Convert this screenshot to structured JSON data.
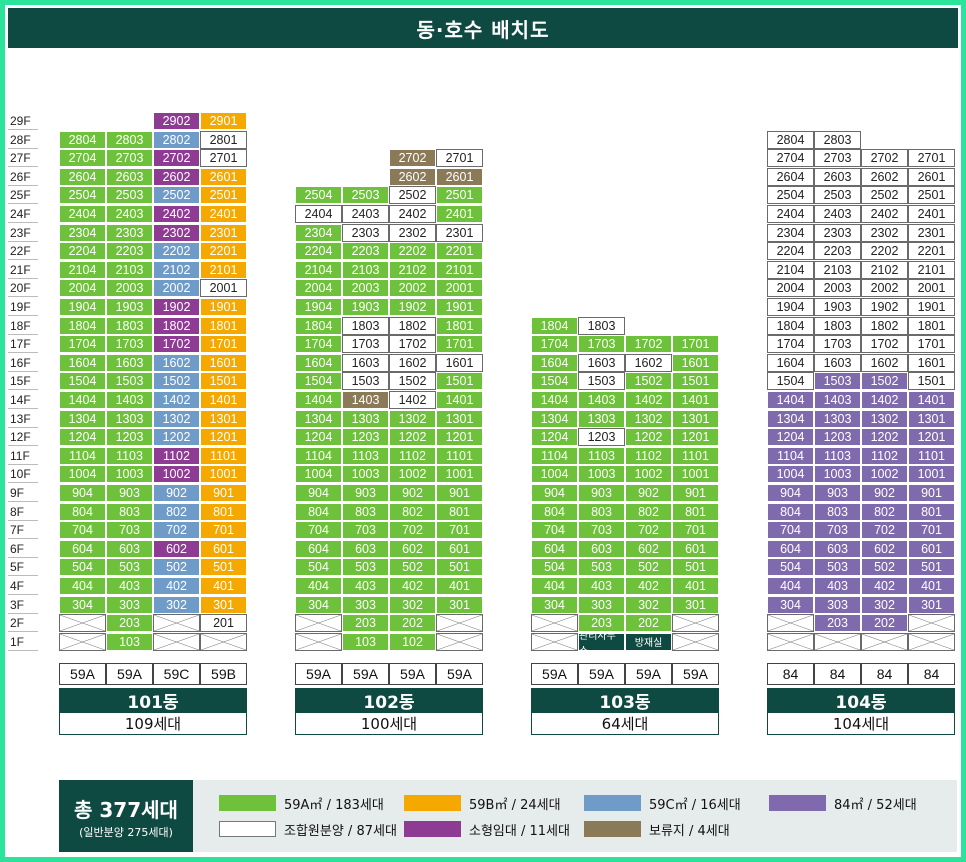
{
  "title": "동·호수 배치도",
  "floors": [
    "29F",
    "28F",
    "27F",
    "26F",
    "25F",
    "24F",
    "23F",
    "22F",
    "21F",
    "20F",
    "19F",
    "18F",
    "17F",
    "16F",
    "15F",
    "14F",
    "13F",
    "12F",
    "11F",
    "10F",
    "9F",
    "8F",
    "7F",
    "6F",
    "5F",
    "4F",
    "3F",
    "2F",
    "1F"
  ],
  "colors": {
    "A": "#6ec13a",
    "B": "#f5a800",
    "C": "#6f9bc9",
    "D": "#7f6aad",
    "W": "#ffffff",
    "R": "#8e3b94",
    "H": "#8a7a57",
    "S": "#0f4a42"
  },
  "buildings": [
    {
      "name": "101동",
      "households": "109세대",
      "types": [
        "59A",
        "59A",
        "59C",
        "59B"
      ],
      "rows": [
        [
          null,
          null,
          "R:2902",
          "B:2901"
        ],
        [
          "A:2804",
          "A:2803",
          "C:2802",
          "W:2801"
        ],
        [
          "A:2704",
          "A:2703",
          "R:2702",
          "W:2701"
        ],
        [
          "A:2604",
          "A:2603",
          "R:2602",
          "B:2601"
        ],
        [
          "A:2504",
          "A:2503",
          "C:2502",
          "B:2501"
        ],
        [
          "A:2404",
          "A:2403",
          "R:2402",
          "B:2401"
        ],
        [
          "A:2304",
          "A:2303",
          "R:2302",
          "B:2301"
        ],
        [
          "A:2204",
          "A:2203",
          "C:2202",
          "B:2201"
        ],
        [
          "A:2104",
          "A:2103",
          "C:2102",
          "B:2101"
        ],
        [
          "A:2004",
          "A:2003",
          "C:2002",
          "W:2001"
        ],
        [
          "A:1904",
          "A:1903",
          "R:1902",
          "B:1901"
        ],
        [
          "A:1804",
          "A:1803",
          "R:1802",
          "B:1801"
        ],
        [
          "A:1704",
          "A:1703",
          "R:1702",
          "B:1701"
        ],
        [
          "A:1604",
          "A:1603",
          "C:1602",
          "B:1601"
        ],
        [
          "A:1504",
          "A:1503",
          "C:1502",
          "B:1501"
        ],
        [
          "A:1404",
          "A:1403",
          "C:1402",
          "B:1401"
        ],
        [
          "A:1304",
          "A:1303",
          "C:1302",
          "B:1301"
        ],
        [
          "A:1204",
          "A:1203",
          "C:1202",
          "B:1201"
        ],
        [
          "A:1104",
          "A:1103",
          "R:1102",
          "B:1101"
        ],
        [
          "A:1004",
          "A:1003",
          "R:1002",
          "B:1001"
        ],
        [
          "A:904",
          "A:903",
          "C:902",
          "B:901"
        ],
        [
          "A:804",
          "A:803",
          "C:802",
          "B:801"
        ],
        [
          "A:704",
          "A:703",
          "C:702",
          "B:701"
        ],
        [
          "A:604",
          "A:603",
          "R:602",
          "B:601"
        ],
        [
          "A:504",
          "A:503",
          "C:502",
          "B:501"
        ],
        [
          "A:404",
          "A:403",
          "C:402",
          "B:401"
        ],
        [
          "A:304",
          "A:303",
          "C:302",
          "B:301"
        ],
        [
          "X:",
          "A:203",
          "X:",
          "W:201"
        ],
        [
          "X:",
          "A:103",
          "X:",
          "X:"
        ]
      ]
    },
    {
      "name": "102동",
      "households": "100세대",
      "types": [
        "59A",
        "59A",
        "59A",
        "59A"
      ],
      "rows": [
        [
          null,
          null,
          null,
          null
        ],
        [
          null,
          null,
          null,
          null
        ],
        [
          null,
          null,
          "H:2702",
          "W:2701"
        ],
        [
          null,
          null,
          "H:2602",
          "H:2601"
        ],
        [
          "A:2504",
          "A:2503",
          "W:2502",
          "A:2501"
        ],
        [
          "W:2404",
          "W:2403",
          "W:2402",
          "A:2401"
        ],
        [
          "A:2304",
          "W:2303",
          "W:2302",
          "W:2301"
        ],
        [
          "A:2204",
          "A:2203",
          "A:2202",
          "A:2201"
        ],
        [
          "A:2104",
          "A:2103",
          "A:2102",
          "A:2101"
        ],
        [
          "A:2004",
          "A:2003",
          "A:2002",
          "A:2001"
        ],
        [
          "A:1904",
          "A:1903",
          "A:1902",
          "A:1901"
        ],
        [
          "A:1804",
          "W:1803",
          "W:1802",
          "A:1801"
        ],
        [
          "A:1704",
          "W:1703",
          "W:1702",
          "A:1701"
        ],
        [
          "A:1604",
          "W:1603",
          "W:1602",
          "W:1601"
        ],
        [
          "A:1504",
          "W:1503",
          "W:1502",
          "A:1501"
        ],
        [
          "A:1404",
          "H:1403",
          "W:1402",
          "A:1401"
        ],
        [
          "A:1304",
          "A:1303",
          "A:1302",
          "A:1301"
        ],
        [
          "A:1204",
          "A:1203",
          "A:1202",
          "A:1201"
        ],
        [
          "A:1104",
          "A:1103",
          "A:1102",
          "A:1101"
        ],
        [
          "A:1004",
          "A:1003",
          "A:1002",
          "A:1001"
        ],
        [
          "A:904",
          "A:903",
          "A:902",
          "A:901"
        ],
        [
          "A:804",
          "A:803",
          "A:802",
          "A:801"
        ],
        [
          "A:704",
          "A:703",
          "A:702",
          "A:701"
        ],
        [
          "A:604",
          "A:603",
          "A:602",
          "A:601"
        ],
        [
          "A:504",
          "A:503",
          "A:502",
          "A:501"
        ],
        [
          "A:404",
          "A:403",
          "A:402",
          "A:401"
        ],
        [
          "A:304",
          "A:303",
          "A:302",
          "A:301"
        ],
        [
          "X:",
          "A:203",
          "A:202",
          "X:"
        ],
        [
          "X:",
          "A:103",
          "A:102",
          "X:"
        ]
      ]
    },
    {
      "name": "103동",
      "households": "64세대",
      "types": [
        "59A",
        "59A",
        "59A",
        "59A"
      ],
      "rows": [
        [
          null,
          null,
          null,
          null
        ],
        [
          null,
          null,
          null,
          null
        ],
        [
          null,
          null,
          null,
          null
        ],
        [
          null,
          null,
          null,
          null
        ],
        [
          null,
          null,
          null,
          null
        ],
        [
          null,
          null,
          null,
          null
        ],
        [
          null,
          null,
          null,
          null
        ],
        [
          null,
          null,
          null,
          null
        ],
        [
          null,
          null,
          null,
          null
        ],
        [
          null,
          null,
          null,
          null
        ],
        [
          null,
          null,
          null,
          null
        ],
        [
          "A:1804",
          "W:1803",
          null,
          null
        ],
        [
          "A:1704",
          "A:1703",
          "A:1702",
          "A:1701"
        ],
        [
          "A:1604",
          "W:1603",
          "W:1602",
          "A:1601"
        ],
        [
          "A:1504",
          "W:1503",
          "A:1502",
          "A:1501"
        ],
        [
          "A:1404",
          "A:1403",
          "A:1402",
          "A:1401"
        ],
        [
          "A:1304",
          "A:1303",
          "A:1302",
          "A:1301"
        ],
        [
          "A:1204",
          "W:1203",
          "A:1202",
          "A:1201"
        ],
        [
          "A:1104",
          "A:1103",
          "A:1102",
          "A:1101"
        ],
        [
          "A:1004",
          "A:1003",
          "A:1002",
          "A:1001"
        ],
        [
          "A:904",
          "A:903",
          "A:902",
          "A:901"
        ],
        [
          "A:804",
          "A:803",
          "A:802",
          "A:801"
        ],
        [
          "A:704",
          "A:703",
          "A:702",
          "A:701"
        ],
        [
          "A:604",
          "A:603",
          "A:602",
          "A:601"
        ],
        [
          "A:504",
          "A:503",
          "A:502",
          "A:501"
        ],
        [
          "A:404",
          "A:403",
          "A:402",
          "A:401"
        ],
        [
          "A:304",
          "A:303",
          "A:302",
          "A:301"
        ],
        [
          "X:",
          "A:203",
          "A:202",
          "X:"
        ],
        [
          "X:",
          "S:관리사무소",
          "S:방재실",
          "X:"
        ]
      ]
    },
    {
      "name": "104동",
      "households": "104세대",
      "types": [
        "84",
        "84",
        "84",
        "84"
      ],
      "rows": [
        [
          null,
          null,
          null,
          null
        ],
        [
          "W:2804",
          "W:2803",
          null,
          null
        ],
        [
          "W:2704",
          "W:2703",
          "W:2702",
          "W:2701"
        ],
        [
          "W:2604",
          "W:2603",
          "W:2602",
          "W:2601"
        ],
        [
          "W:2504",
          "W:2503",
          "W:2502",
          "W:2501"
        ],
        [
          "W:2404",
          "W:2403",
          "W:2402",
          "W:2401"
        ],
        [
          "W:2304",
          "W:2303",
          "W:2302",
          "W:2301"
        ],
        [
          "W:2204",
          "W:2203",
          "W:2202",
          "W:2201"
        ],
        [
          "W:2104",
          "W:2103",
          "W:2102",
          "W:2101"
        ],
        [
          "W:2004",
          "W:2003",
          "W:2002",
          "W:2001"
        ],
        [
          "W:1904",
          "W:1903",
          "W:1902",
          "W:1901"
        ],
        [
          "W:1804",
          "W:1803",
          "W:1802",
          "W:1801"
        ],
        [
          "W:1704",
          "W:1703",
          "W:1702",
          "W:1701"
        ],
        [
          "W:1604",
          "W:1603",
          "W:1602",
          "W:1601"
        ],
        [
          "W:1504",
          "D:1503",
          "D:1502",
          "W:1501"
        ],
        [
          "D:1404",
          "D:1403",
          "D:1402",
          "D:1401"
        ],
        [
          "D:1304",
          "D:1303",
          "D:1302",
          "D:1301"
        ],
        [
          "D:1204",
          "D:1203",
          "D:1202",
          "D:1201"
        ],
        [
          "D:1104",
          "D:1103",
          "D:1102",
          "D:1101"
        ],
        [
          "D:1004",
          "D:1003",
          "D:1002",
          "D:1001"
        ],
        [
          "D:904",
          "D:903",
          "D:902",
          "D:901"
        ],
        [
          "D:804",
          "D:803",
          "D:802",
          "D:801"
        ],
        [
          "D:704",
          "D:703",
          "D:702",
          "D:701"
        ],
        [
          "D:604",
          "D:603",
          "D:602",
          "D:601"
        ],
        [
          "D:504",
          "D:503",
          "D:502",
          "D:501"
        ],
        [
          "D:404",
          "D:403",
          "D:402",
          "D:401"
        ],
        [
          "D:304",
          "D:303",
          "D:302",
          "D:301"
        ],
        [
          "X:",
          "D:203",
          "D:202",
          "X:"
        ],
        [
          "X:",
          "X:",
          "X:",
          "X:"
        ]
      ]
    }
  ],
  "legend": {
    "total": "총 377세대",
    "total_sub": "(일반분양 275세대)",
    "items": [
      {
        "key": "A",
        "label": "59A㎡ / 183세대"
      },
      {
        "key": "B",
        "label": "59B㎡ / 24세대"
      },
      {
        "key": "C",
        "label": "59C㎡ / 16세대"
      },
      {
        "key": "D",
        "label": "84㎡ / 52세대"
      },
      {
        "key": "W",
        "label": "조합원분양 / 87세대"
      },
      {
        "key": "R",
        "label": "소형임대 / 11세대"
      },
      {
        "key": "H",
        "label": "보류지 / 4세대"
      }
    ]
  }
}
